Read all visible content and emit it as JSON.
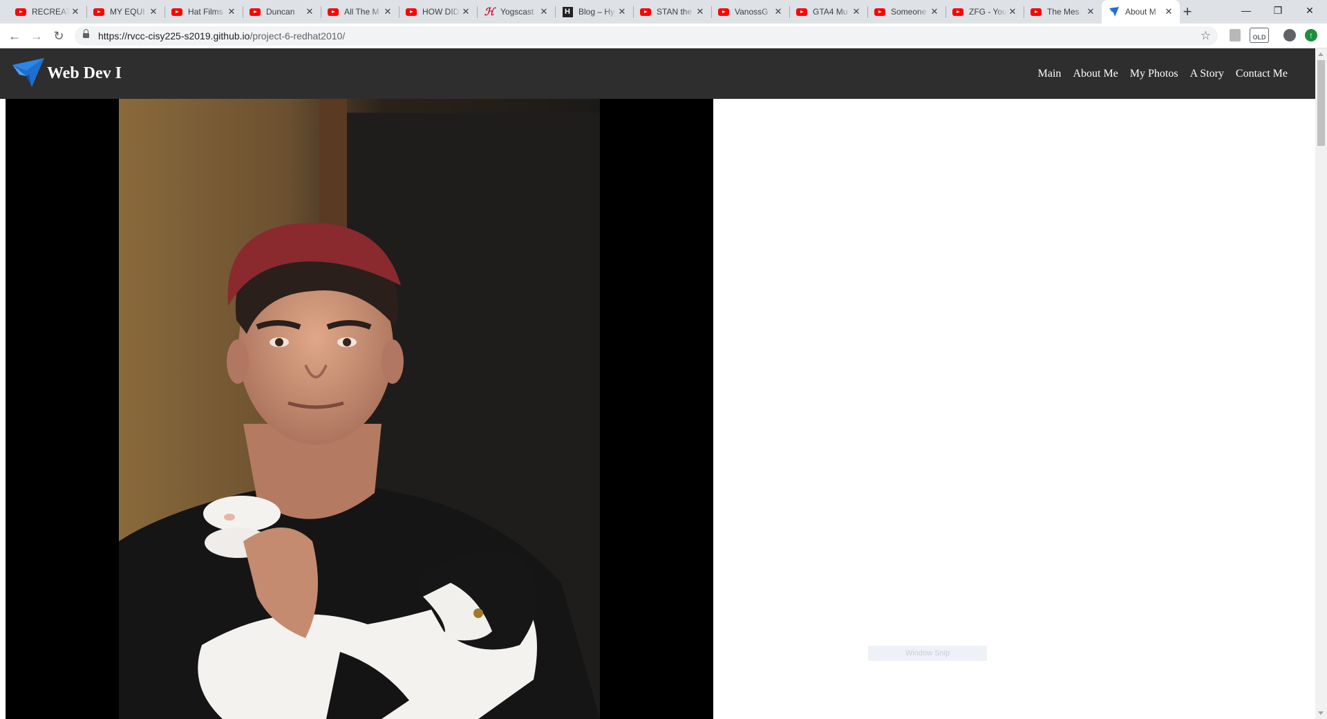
{
  "browser": {
    "tabs": [
      {
        "title": "RECREATI",
        "favicon": "youtube-icon",
        "active": false
      },
      {
        "title": "MY EQUI",
        "favicon": "youtube-icon",
        "active": false
      },
      {
        "title": "Hat Films",
        "favicon": "youtube-icon",
        "active": false
      },
      {
        "title": "Duncan",
        "favicon": "youtube-icon",
        "active": false
      },
      {
        "title": "All The M",
        "favicon": "youtube-icon",
        "active": false
      },
      {
        "title": "HOW DID",
        "favicon": "youtube-icon",
        "active": false
      },
      {
        "title": "Yogscast",
        "favicon": "h-logo-icon",
        "active": false
      },
      {
        "title": "Blog – Hy",
        "favicon": "blog-icon",
        "active": false
      },
      {
        "title": "STAN the",
        "favicon": "youtube-icon",
        "active": false
      },
      {
        "title": "VanossG",
        "favicon": "youtube-icon",
        "active": false
      },
      {
        "title": "GTA4 Mu",
        "favicon": "youtube-icon",
        "active": false
      },
      {
        "title": "Someone",
        "favicon": "youtube-icon",
        "active": false
      },
      {
        "title": "ZFG - You",
        "favicon": "youtube-icon",
        "active": false
      },
      {
        "title": "The Mes",
        "favicon": "youtube-icon",
        "active": false
      },
      {
        "title": "About M",
        "favicon": "bird-logo-icon",
        "active": true
      }
    ],
    "url_host": "https://rvcc-cisy225-s2019.github.io",
    "url_path": "/project-6-redhat2010/",
    "extension_old_label": "OLD"
  },
  "site": {
    "brand": "Web Dev I",
    "nav": [
      "Main",
      "About Me",
      "My Photos",
      "A Story",
      "Contact Me"
    ],
    "colors": {
      "header_bg": "#2e2e2e",
      "accent": "#1e6fd0"
    }
  },
  "overlay": {
    "snap_label": "Window Snip"
  }
}
